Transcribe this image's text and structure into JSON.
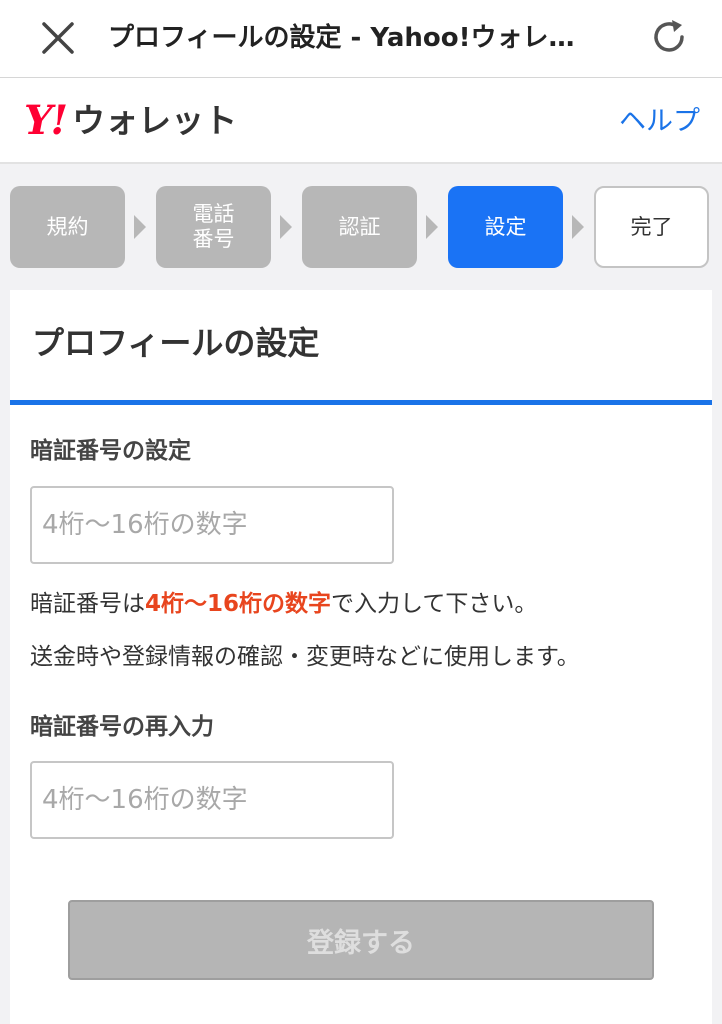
{
  "browser": {
    "title": "プロフィールの設定 - Yahoo!ウォレ…"
  },
  "header": {
    "logo_mark": "Y!",
    "logo_text": "ウォレット",
    "help_link": "ヘルプ"
  },
  "steps": [
    {
      "label": "規約",
      "state": "done"
    },
    {
      "label": "電話\n番号",
      "state": "done"
    },
    {
      "label": "認証",
      "state": "done"
    },
    {
      "label": "設定",
      "state": "active"
    },
    {
      "label": "完了",
      "state": "pending"
    }
  ],
  "card": {
    "title": "プロフィールの設定",
    "pin": {
      "label": "暗証番号の設定",
      "placeholder": "4桁〜16桁の数字",
      "value": ""
    },
    "note1_pre": "暗証番号は",
    "note1_highlight": "4桁〜16桁の数字",
    "note1_post": "で入力して下さい。",
    "note2": "送金時や登録情報の確認・変更時などに使用します。",
    "pin_confirm": {
      "label": "暗証番号の再入力",
      "placeholder": "4桁〜16桁の数字",
      "value": ""
    },
    "submit_label": "登録する"
  },
  "colors": {
    "accent": "#1a73e8",
    "brand_red": "#ff0033",
    "highlight": "#e8451e",
    "disabled_button": "#b5b5b5"
  }
}
